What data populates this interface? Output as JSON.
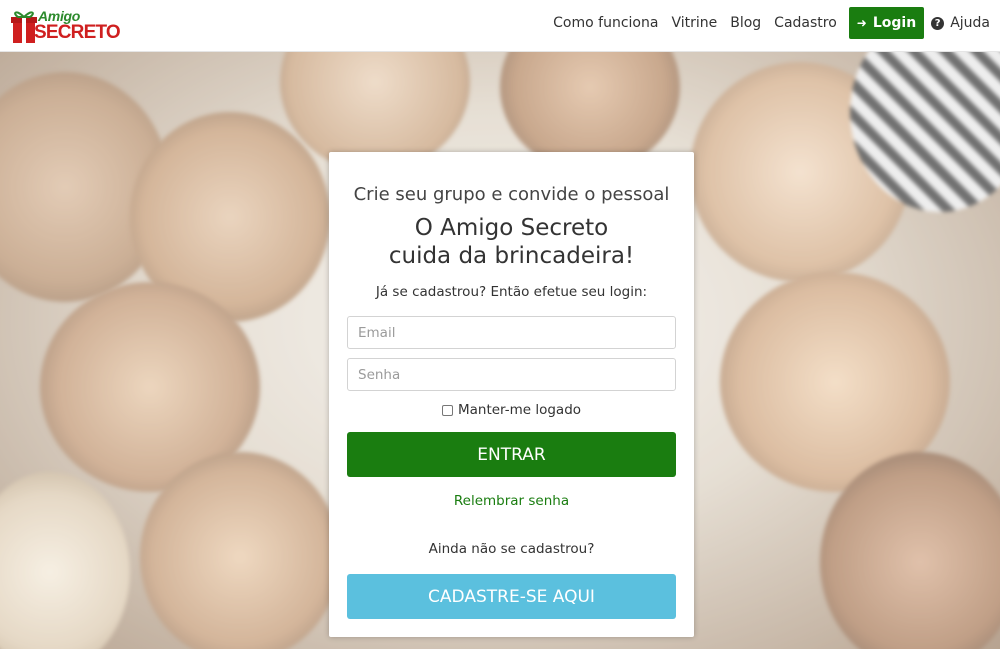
{
  "brand": {
    "line1": "Amigo",
    "line2": "SECRETO"
  },
  "nav": {
    "items": [
      "Como funciona",
      "Vitrine",
      "Blog",
      "Cadastro"
    ],
    "login_label": "Login",
    "help_label": "Ajuda"
  },
  "card": {
    "subtitle": "Crie seu grupo e convide o pessoal",
    "headline_line1": "O Amigo Secreto",
    "headline_line2": "cuida da brincadeira!",
    "prompt": "Já se cadastrou? Então efetue seu login:",
    "email_placeholder": "Email",
    "password_placeholder": "Senha",
    "remember_label": "Manter-me logado",
    "submit_label": "ENTRAR",
    "forgot_label": "Relembrar senha",
    "not_registered": "Ainda não se cadastrou?",
    "register_label": "CADASTRE-SE AQUI"
  },
  "colors": {
    "primary_green": "#1a7d10",
    "info_blue": "#5bc0de",
    "brand_red": "#cf1f1f"
  }
}
